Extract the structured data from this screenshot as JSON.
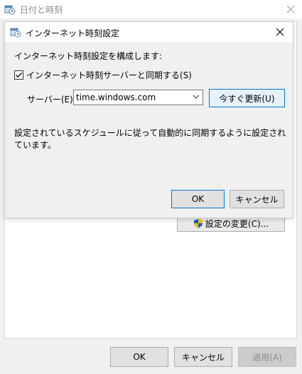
{
  "parent_window": {
    "title": "日付と時刻",
    "change_settings_button": "設定の変更(C)...",
    "ok_button": "OK",
    "cancel_button": "キャンセル",
    "apply_button": "適用(A)"
  },
  "dialog": {
    "title": "インターネット時刻設定",
    "heading": "インターネット時刻設定を構成します:",
    "sync_checkbox_label": "インターネット時刻サーバーと同期する(S)",
    "sync_checked": true,
    "server_label": "サーバー(E):",
    "server_value": "time.windows.com",
    "update_now_button": "今すぐ更新(U)",
    "status_text": "設定されているスケジュールに従って自動的に同期するように設定されています。",
    "ok_button": "OK",
    "cancel_button": "キャンセル"
  },
  "colors": {
    "accent": "#0078d7",
    "window_bg": "#f0f0f0"
  },
  "icons": {
    "title_icon": "clock-calendar-icon",
    "close_icon": "close-icon",
    "shield_icon": "uac-shield-icon",
    "dropdown_icon": "chevron-down-icon"
  }
}
